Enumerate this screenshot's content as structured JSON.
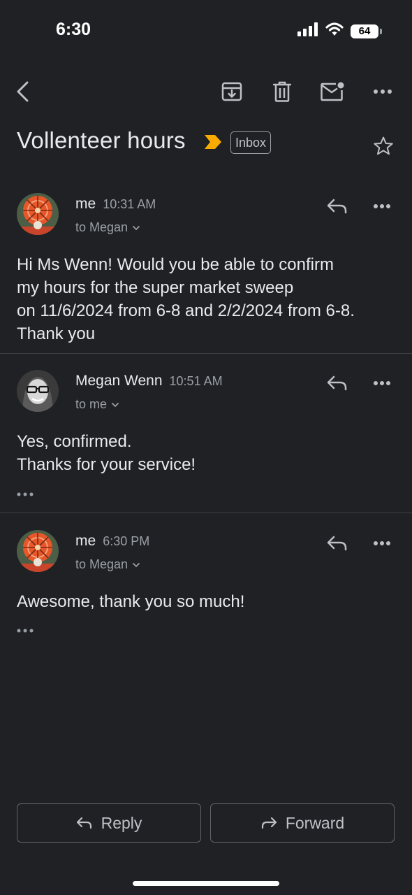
{
  "status_bar": {
    "time": "6:30",
    "battery": "64"
  },
  "toolbar": {
    "icons": [
      "back-icon",
      "archive-icon",
      "delete-icon",
      "mark-unread-icon",
      "more-icon"
    ]
  },
  "thread": {
    "subject": "Vollenteer hours",
    "label": "Inbox"
  },
  "messages": [
    {
      "sender": "me",
      "time": "10:31 AM",
      "recipient": "to Megan",
      "body_lines": [
        "Hi  Ms Wenn! Would you be able to confirm",
        "my hours for the super market sweep",
        "on 11/6/2024 from 6-8 and 2/2/2024 from 6-8.",
        "Thank you"
      ]
    },
    {
      "sender": "Megan Wenn",
      "time": "10:51 AM",
      "recipient": "to me",
      "body_lines": [
        "Yes, confirmed.",
        "Thanks for your service!"
      ]
    },
    {
      "sender": "me",
      "time": "6:30 PM",
      "recipient": "to Megan",
      "body_lines": [
        "Awesome, thank you so much!"
      ]
    }
  ],
  "actions": {
    "reply": "Reply",
    "forward": "Forward"
  },
  "colors": {
    "background": "#202124",
    "text": "#e8eaed",
    "secondary": "#9aa0a6",
    "importance": "#f9ab00",
    "avatar_accent": "#e8572a"
  }
}
